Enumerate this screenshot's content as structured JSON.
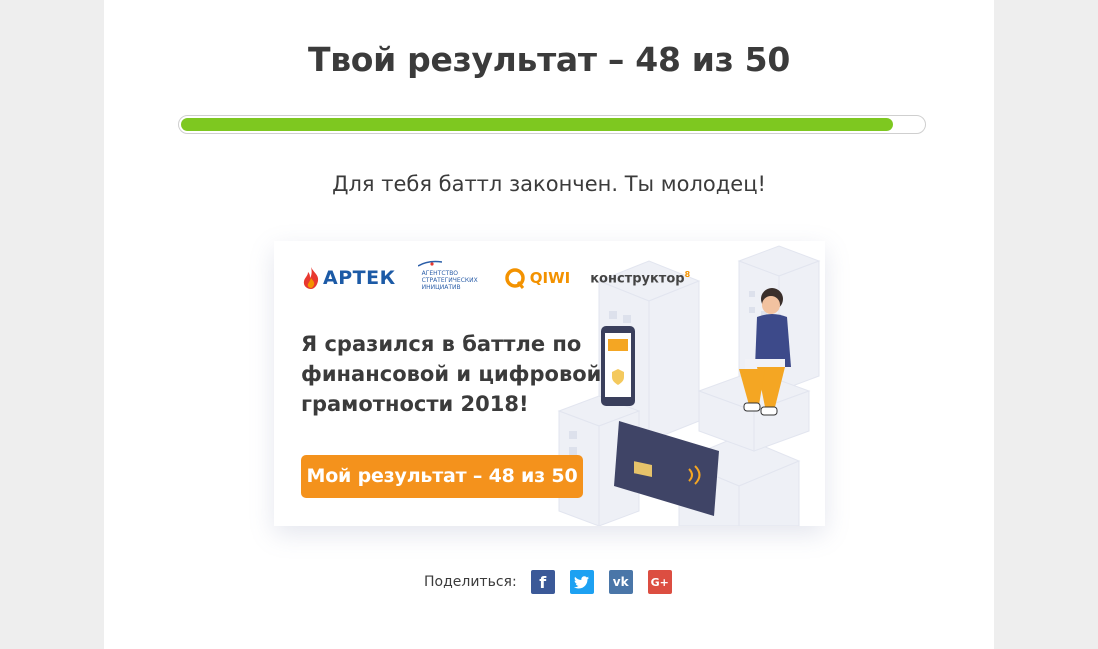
{
  "result": {
    "title": "Твой результат – 48 из 50",
    "score": 48,
    "max": 50,
    "progress_color": "#7ec820",
    "message": "Для тебя баттл закончен. Ты молодец!"
  },
  "card": {
    "logos": {
      "artek": "АРТЕК",
      "asi_line1": "Агентство",
      "asi_line2": "стратегических",
      "asi_line3": "инициатив",
      "qiwi": "QIWI",
      "konstruktor": "конструктор",
      "konstruktor_sup": "8"
    },
    "text": "Я сразился в баттле по финансовой и цифровой грамотности 2018!",
    "button_label": "Мой результат – 48 из 50",
    "button_color": "#f4921c"
  },
  "share": {
    "label": "Поделиться:",
    "networks": [
      {
        "name": "facebook",
        "glyph": "f",
        "color": "#3b5998"
      },
      {
        "name": "twitter",
        "glyph": "t",
        "color": "#1da1f2"
      },
      {
        "name": "vk",
        "glyph": "vk",
        "color": "#4a76a8"
      },
      {
        "name": "googleplus",
        "glyph": "G+",
        "color": "#dc4e41"
      }
    ]
  }
}
